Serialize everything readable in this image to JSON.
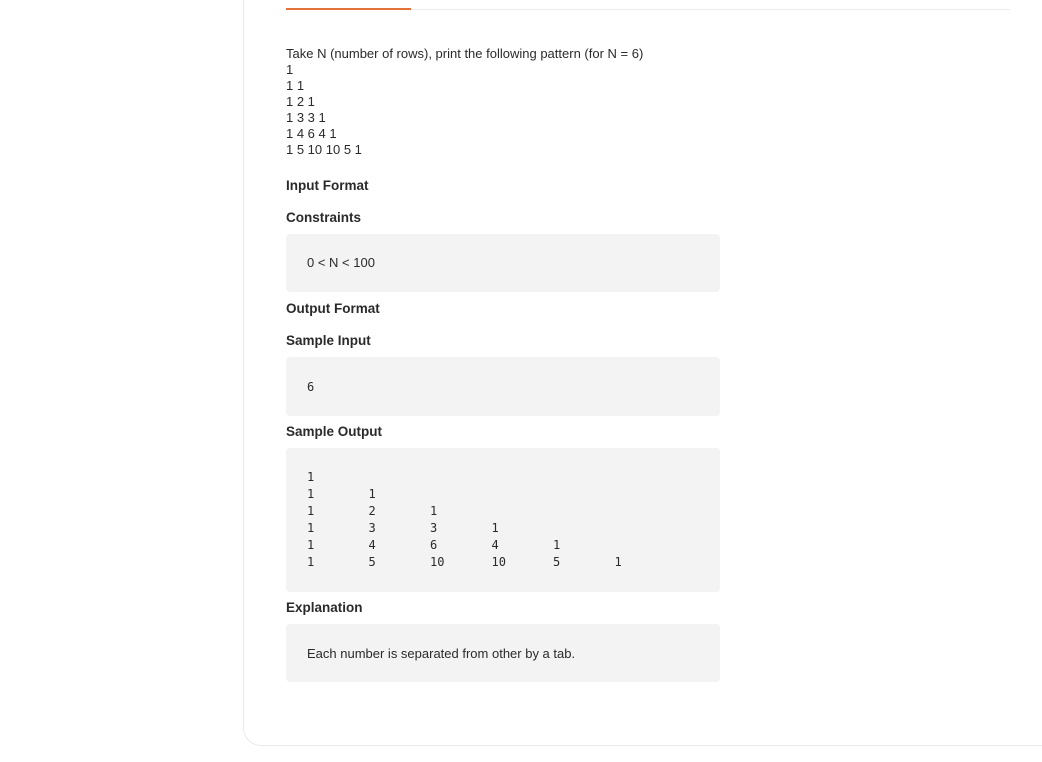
{
  "problem": {
    "description": "Take N (number of rows), print the following pattern (for N = 6)",
    "pattern_lines": [
      "1",
      "1 1",
      "1 2 1",
      "1 3 3 1",
      "1 4 6 4 1",
      "1 5 10 10 5 1"
    ]
  },
  "sections": {
    "input_format_heading": "Input Format",
    "constraints_heading": "Constraints",
    "constraints_text": "0 < N < 100",
    "output_format_heading": "Output Format",
    "sample_input_heading": "Sample Input",
    "sample_input_value": "6",
    "sample_output_heading": "Sample Output",
    "sample_output_rows": [
      [
        "1"
      ],
      [
        "1",
        "1"
      ],
      [
        "1",
        "2",
        "1"
      ],
      [
        "1",
        "3",
        "3",
        "1"
      ],
      [
        "1",
        "4",
        "6",
        "4",
        "1"
      ],
      [
        "1",
        "5",
        "10",
        "10",
        "5",
        "1"
      ]
    ],
    "explanation_heading": "Explanation",
    "explanation_text": "Each number is separated from other by a tab."
  },
  "colors": {
    "accent": "#e4703c",
    "box_background": "#f3f3f3"
  }
}
